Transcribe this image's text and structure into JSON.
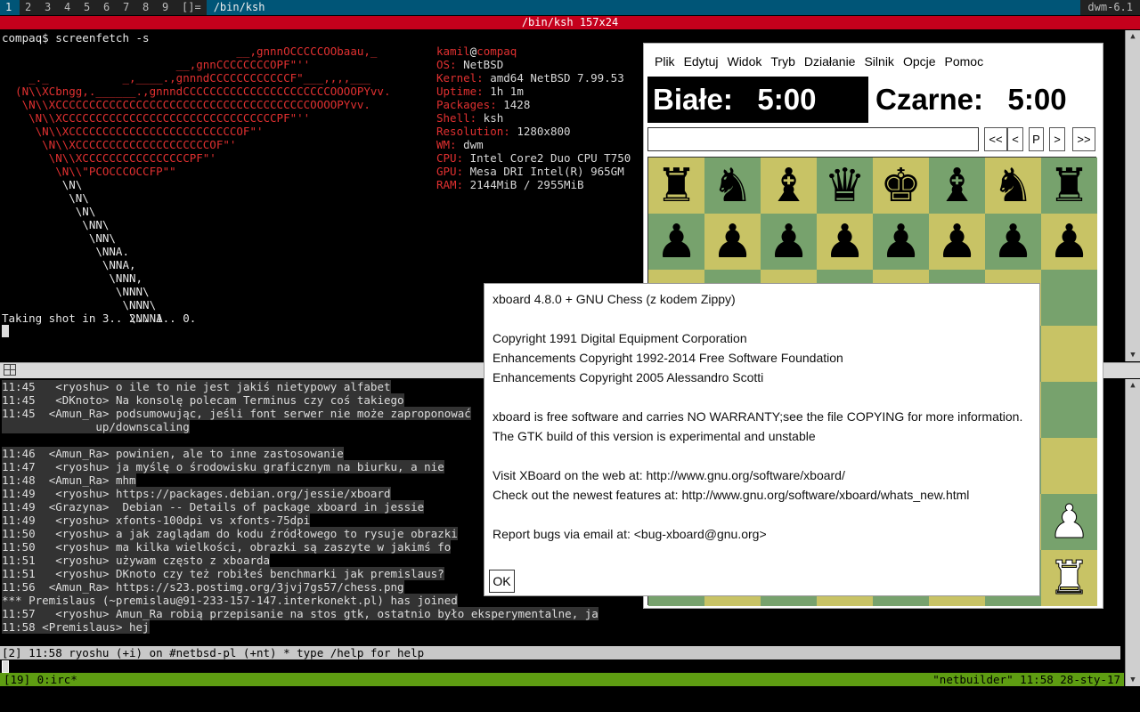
{
  "bar": {
    "tags": [
      "1",
      "2",
      "3",
      "4",
      "5",
      "6",
      "7",
      "8",
      "9"
    ],
    "layout": "[]=",
    "title": "/bin/ksh",
    "wm_version": "dwm-6.1"
  },
  "term1": {
    "title": "/bin/ksh 157x24",
    "prompt": "compaq$ screenfetch -s",
    "logo": [
      "                                   __,gnnnOCCCCCOObaau,_",
      "                          __,gnnCCCCCCCCOPF\"''",
      "    _._           _,____.,gnnndCCCCCCCCCCCCF\"___,,,,___",
      "  (N\\\\XCbngg,.______.,gnnndCCCCCCCCCCCCCCCCCCCCCCOOOOPYvv.",
      "   \\N\\\\XCCCCCCCCCCCCCCCCCCCCCCCCCCCCCCCCCCCCCCOOOOPYvv.",
      "    \\N\\\\XCCCCCCCCCCCCCCCCCCCCCCCCCCCCCCCCPF\"''",
      "     \\N\\\\XCCCCCCCCCCCCCCCCCCCCCCCCCOF\"'",
      "      \\N\\\\XCCCCCCCCCCCCCCCCCCCCOF\"'",
      "       \\N\\\\XCCCCCCCCCCCCCCCCPF\"'",
      "        \\N\\\\\"PCOCCCOCCFP\"\"",
      "         \\N\\",
      "          \\N\\",
      "           \\N\\",
      "            \\NN\\",
      "             \\NN\\",
      "              \\NNA.",
      "               \\NNA,",
      "                \\NNN,",
      "                 \\NNN\\",
      "                  \\NNN\\",
      "                   \\NNNA"
    ],
    "info_user": "kamil",
    "info_at": "@",
    "info_host": "compaq",
    "info": [
      {
        "k": "OS:",
        "v": " NetBSD"
      },
      {
        "k": "Kernel:",
        "v": " amd64 NetBSD 7.99.53"
      },
      {
        "k": "Uptime:",
        "v": " 1h 1m"
      },
      {
        "k": "Packages:",
        "v": " 1428"
      },
      {
        "k": "Shell:",
        "v": " ksh"
      },
      {
        "k": "Resolution:",
        "v": " 1280x800"
      },
      {
        "k": "WM:",
        "v": " dwm"
      },
      {
        "k": "CPU:",
        "v": " Intel Core2 Duo CPU T750"
      },
      {
        "k": "GPU:",
        "v": " Mesa DRI Intel(R) 965GM"
      },
      {
        "k": "RAM:",
        "v": " 2144MiB / 2955MiB"
      }
    ],
    "shot": "Taking shot in 3.. 2.. 1.. 0."
  },
  "irc": {
    "lines": [
      {
        "t": "11:45",
        "n": "   <ryoshu>",
        "m": " o ile to nie jest jakiś nietypowy alfabet",
        "hl": true
      },
      {
        "t": "11:45",
        "n": "   <DKnoto>",
        "m": " Na konsolę polecam Terminus czy coś takiego",
        "hl": true
      },
      {
        "t": "11:45",
        "n": "  <Amun_Ra>",
        "m": " podsumowując, jeśli font serwer nie może zaproponować",
        "hl": true
      },
      {
        "t": "",
        "n": "",
        "m": "              up/downscaling",
        "hl": true
      },
      {
        "t": "",
        "n": "",
        "m": "",
        "hl": false
      },
      {
        "t": "11:46",
        "n": "  <Amun_Ra>",
        "m": " powinien, ale to inne zastosowanie",
        "hl": true
      },
      {
        "t": "11:47",
        "n": "   <ryoshu>",
        "m": " ja myślę o środowisku graficznym na biurku, a nie",
        "hl": true
      },
      {
        "t": "11:48",
        "n": "  <Amun_Ra>",
        "m": " mhm",
        "hl": true
      },
      {
        "t": "11:49",
        "n": "   <ryoshu>",
        "m": " https://packages.debian.org/jessie/xboard",
        "hl": true
      },
      {
        "t": "11:49",
        "n": "  <Grazyna>",
        "m": "  Debian -- Details of package xboard in jessie",
        "hl": true
      },
      {
        "t": "11:49",
        "n": "   <ryoshu>",
        "m": " xfonts-100dpi vs xfonts-75dpi",
        "hl": true
      },
      {
        "t": "11:50",
        "n": "   <ryoshu>",
        "m": " a jak zaglądam do kodu źródłowego to rysuje obrazki",
        "hl": true
      },
      {
        "t": "11:50",
        "n": "   <ryoshu>",
        "m": " ma kilka wielkości, obrazki są zaszyte w jakimś fo",
        "hl": true
      },
      {
        "t": "11:51",
        "n": "   <ryoshu>",
        "m": " używam często z xboarda",
        "hl": true
      },
      {
        "t": "11:51",
        "n": "   <ryoshu>",
        "m": " DKnoto czy też robiłeś benchmarki jak premislaus?",
        "hl": true
      },
      {
        "t": "11:56",
        "n": "  <Amun_Ra>",
        "m": " https://s23.postimg.org/3jvj7gs57/chess.png",
        "hl": true
      },
      {
        "t": "",
        "n": "",
        "m": "*** Premislaus (~premislau@91-233-157-147.interkonekt.pl) has joined",
        "hl": true
      },
      {
        "t": "11:57",
        "n": "   <ryoshu>",
        "m": " Amun_Ra robią przepisanie na stos gtk, ostatnio było eksperymentalne, ja",
        "hl": true
      },
      {
        "t": "11:58",
        "n": " <Premislaus>",
        "m": " hej",
        "hl": true
      }
    ],
    "status": "[2] 11:58 ryoshu (+i) on #netbsd-pl (+nt) * type /help for help"
  },
  "tmux": {
    "left": "[19] 0:irc*",
    "right": "\"netbuilder\" 11:58 28-sty-17"
  },
  "xboard": {
    "menu": [
      "Plik",
      "Edytuj",
      "Widok",
      "Tryb",
      "Działanie",
      "Silnik",
      "Opcje",
      "Pomoc"
    ],
    "white_label": "Białe:",
    "white_time": "5:00",
    "black_label": "Czarne:",
    "black_time": "5:00",
    "nav": [
      "<<",
      "<",
      "P",
      ">",
      ">>"
    ],
    "board": [
      [
        "r",
        "n",
        "b",
        "q",
        "k",
        "b",
        "n",
        "r"
      ],
      [
        "p",
        "p",
        "p",
        "p",
        "p",
        "p",
        "p",
        "p"
      ],
      [
        "",
        "",
        "",
        "",
        "",
        "",
        "",
        ""
      ],
      [
        "",
        "",
        "",
        "",
        "",
        "",
        "",
        ""
      ],
      [
        "",
        "",
        "",
        "",
        "",
        "",
        "",
        ""
      ],
      [
        "",
        "",
        "",
        "",
        "",
        "",
        "",
        ""
      ],
      [
        "",
        "",
        "",
        "",
        "",
        "",
        "",
        "P"
      ],
      [
        "",
        "",
        "",
        "",
        "",
        "",
        "",
        "R"
      ]
    ]
  },
  "about": {
    "lines": [
      "xboard 4.8.0 + GNU Chess (z kodem Zippy)",
      "",
      "Copyright 1991 Digital Equipment Corporation",
      "Enhancements Copyright 1992-2014 Free Software Foundation",
      "Enhancements Copyright 2005 Alessandro Scotti",
      "",
      "xboard is free software and carries NO WARRANTY;see the file COPYING for more information.",
      "The GTK build of this version is experimental and unstable",
      "",
      "Visit XBoard on the web at: http://www.gnu.org/software/xboard/",
      "Check out the newest features at: http://www.gnu.org/software/xboard/whats_new.html",
      "",
      "Report bugs via email at: <bug-xboard@gnu.org>"
    ],
    "ok": "OK"
  },
  "colors": {
    "dwm_sel": "#005577",
    "term_title": "#c4001c",
    "tmux_bar": "#5e9d12",
    "board_light": "#c8c365",
    "board_dark": "#77a26d"
  }
}
